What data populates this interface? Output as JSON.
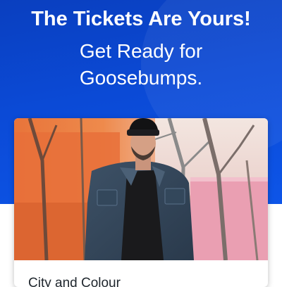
{
  "hero": {
    "headline": "The Tickets Are Yours!",
    "subline_1": "Get Ready for",
    "subline_2": "Goosebumps.",
    "background_color": "#0b4ad6"
  },
  "event_card": {
    "image_alt": "Artist photo: man in beanie and denim jacket standing among bare trees",
    "artist_name": "City and Colour"
  }
}
